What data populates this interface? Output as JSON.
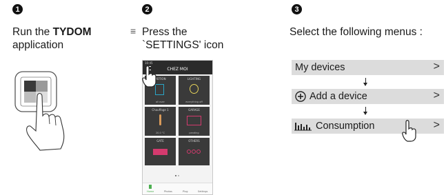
{
  "steps": [
    {
      "number": "1",
      "line1_prefix": "Run the ",
      "line1_bold": "TYDOM",
      "line2": "application"
    },
    {
      "number": "2",
      "line1": "Press the",
      "line2": "`SETTINGS' icon",
      "hamburger": "≡"
    },
    {
      "number": "3",
      "line1": "Select the following menus :"
    }
  ],
  "menu": [
    {
      "label": "My devices",
      "icon": "",
      "chevron": ">"
    },
    {
      "label": "Add a device",
      "icon": "plus-circle-icon",
      "chevron": ">"
    },
    {
      "label": "Consumption",
      "icon": "consumption-bars-icon",
      "chevron": ">"
    }
  ],
  "phone": {
    "title": "CHEZ MOI",
    "time": "10:45",
    "tiles": [
      {
        "title": "MOTION",
        "subtitle": "all over",
        "color": "#2aa6c8"
      },
      {
        "title": "LIGHTING",
        "subtitle": "everything off",
        "color": "#e5d25a"
      },
      {
        "title": "Chauffage 1",
        "subtitle": "20.0 °C",
        "color": "#d89a5a"
      },
      {
        "title": "GARAGE",
        "subtitle": "pending",
        "color": "#d43a6e"
      },
      {
        "title": "GATE",
        "subtitle": "",
        "color": "#d43a6e"
      },
      {
        "title": "OTHERS",
        "subtitle": "",
        "color": "#d43a6e"
      }
    ],
    "nav": [
      "Home",
      "Photos",
      "Plug",
      "Settings"
    ],
    "nav_color": "#4caf50"
  }
}
